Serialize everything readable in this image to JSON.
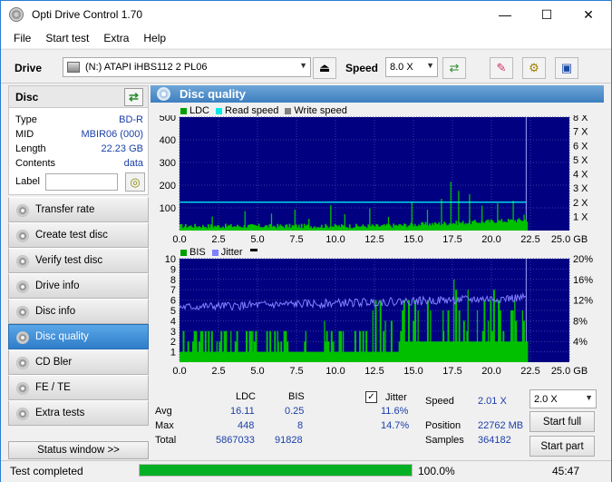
{
  "window": {
    "title": "Opti Drive Control 1.70",
    "minimize": "—",
    "maximize": "☐",
    "close": "✕"
  },
  "menu": [
    "File",
    "Start test",
    "Extra",
    "Help"
  ],
  "toolbar": {
    "drive_label": "Drive",
    "drive_value": "(N:)  ATAPI iHBS112  2 PL06",
    "speed_label": "Speed",
    "speed_value": "8.0 X"
  },
  "disc": {
    "header": "Disc",
    "rows": [
      {
        "key": "Type",
        "value": "BD-R"
      },
      {
        "key": "MID",
        "value": "MBIR06 (000)"
      },
      {
        "key": "Length",
        "value": "22.23 GB"
      },
      {
        "key": "Contents",
        "value": "data"
      }
    ],
    "label_key": "Label"
  },
  "nav": [
    {
      "label": "Transfer rate",
      "active": false
    },
    {
      "label": "Create test disc",
      "active": false
    },
    {
      "label": "Verify test disc",
      "active": false
    },
    {
      "label": "Drive info",
      "active": false
    },
    {
      "label": "Disc info",
      "active": false
    },
    {
      "label": "Disc quality",
      "active": true
    },
    {
      "label": "CD Bler",
      "active": false
    },
    {
      "label": "FE / TE",
      "active": false
    },
    {
      "label": "Extra tests",
      "active": false
    }
  ],
  "status_window": "Status window >>",
  "panel_title": "Disc quality",
  "chart_data": [
    {
      "type": "bar",
      "legend": [
        "LDC",
        "Read speed",
        "Write speed"
      ],
      "colors": {
        "LDC": "#00c000",
        "Read speed": "#00ffff",
        "Write speed": "#909090",
        "background": "#000080"
      },
      "x_ticks": [
        "0.0",
        "2.5",
        "5.0",
        "7.5",
        "10.0",
        "12.5",
        "15.0",
        "17.5",
        "20.0",
        "22.5",
        "25.0 GB"
      ],
      "y_ticks": [
        "100",
        "200",
        "300",
        "400",
        "500"
      ],
      "y2_ticks": [
        "1 X",
        "2 X",
        "3 X",
        "4 X",
        "5 X",
        "6 X",
        "7 X",
        "8 X"
      ],
      "xlim": [
        0,
        25
      ],
      "ylim": [
        0,
        500
      ],
      "y2lim": [
        0,
        8
      ],
      "ldc_baseline": 20,
      "ldc_peaks": [
        [
          2.1,
          62
        ],
        [
          4.2,
          85
        ],
        [
          5.9,
          75
        ],
        [
          7.4,
          92
        ],
        [
          8.3,
          52
        ],
        [
          9.7,
          112
        ],
        [
          10.6,
          72
        ],
        [
          12.2,
          98
        ],
        [
          13.4,
          60
        ],
        [
          14.9,
          125
        ],
        [
          15.9,
          92
        ],
        [
          16.8,
          140
        ],
        [
          17.4,
          215
        ],
        [
          17.9,
          175
        ],
        [
          18.6,
          160
        ],
        [
          19.4,
          110
        ],
        [
          20.4,
          120
        ],
        [
          21.4,
          132
        ],
        [
          22.1,
          70
        ]
      ],
      "read_speed_x": 2.0,
      "read_speed_end_gb": 22.23
    },
    {
      "type": "bar",
      "legend": [
        "BIS",
        "Jitter"
      ],
      "colors": {
        "BIS": "#00c000",
        "Jitter": "#8080ff",
        "background": "#000080"
      },
      "x_ticks": [
        "0.0",
        "2.5",
        "5.0",
        "7.5",
        "10.0",
        "12.5",
        "15.0",
        "17.5",
        "20.0",
        "22.5",
        "25.0 GB"
      ],
      "y_ticks": [
        "1",
        "2",
        "3",
        "4",
        "5",
        "6",
        "7",
        "8",
        "9",
        "10"
      ],
      "y2_ticks": [
        "4%",
        "8%",
        "12%",
        "16%",
        "20%"
      ],
      "xlim": [
        0,
        25
      ],
      "ylim": [
        0,
        10
      ],
      "y2lim": [
        0,
        20
      ],
      "bis_baseline": 1,
      "bis_peaks": [
        [
          1.1,
          2
        ],
        [
          2.4,
          2
        ],
        [
          3.3,
          3
        ],
        [
          4.7,
          3
        ],
        [
          6.3,
          3
        ],
        [
          8.1,
          3
        ],
        [
          9.3,
          4
        ],
        [
          10.5,
          3
        ],
        [
          12.4,
          5
        ],
        [
          13.2,
          4
        ],
        [
          14.4,
          6
        ],
        [
          15.3,
          5
        ],
        [
          16.1,
          5
        ],
        [
          16.9,
          5
        ],
        [
          17.6,
          8
        ],
        [
          18.5,
          7
        ],
        [
          19.1,
          5
        ],
        [
          19.8,
          4
        ],
        [
          20.5,
          6
        ],
        [
          21.5,
          6
        ],
        [
          22.0,
          5
        ]
      ],
      "jitter_start": 10.6,
      "jitter_end": 12.4
    }
  ],
  "stats": {
    "col_ldc": "LDC",
    "col_bis": "BIS",
    "jitter_label": "Jitter",
    "rows": [
      {
        "label": "Avg",
        "ldc": "16.11",
        "bis": "0.25",
        "jitter": "11.6%"
      },
      {
        "label": "Max",
        "ldc": "448",
        "bis": "8",
        "jitter": "14.7%"
      },
      {
        "label": "Total",
        "ldc": "5867033",
        "bis": "91828",
        "jitter": ""
      }
    ],
    "speed_label": "Speed",
    "speed_value": "2.01 X",
    "position_label": "Position",
    "position_value": "22762 MB",
    "samples_label": "Samples",
    "samples_value": "364182",
    "speed_select": "2.0 X",
    "start_full": "Start full",
    "start_part": "Start part"
  },
  "status": {
    "text": "Test completed",
    "progress": 100,
    "progress_text": "100.0%",
    "time": "45:47"
  }
}
